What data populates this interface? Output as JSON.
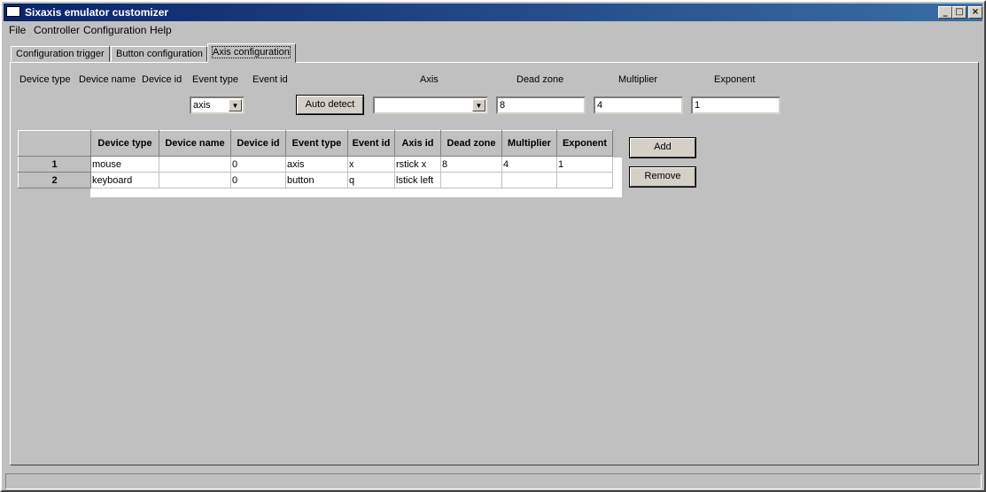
{
  "window": {
    "title": "Sixaxis emulator customizer"
  },
  "menu": [
    {
      "label": "File"
    },
    {
      "label": "Controller"
    },
    {
      "label": "Configuration"
    },
    {
      "label": "Help"
    }
  ],
  "tabs": [
    {
      "label": "Configuration trigger"
    },
    {
      "label": "Button configuration"
    },
    {
      "label": "Axis configuration"
    }
  ],
  "form": {
    "labels": {
      "device_type": "Device type",
      "device_name": "Device name",
      "device_id": "Device id",
      "event_type": "Event type",
      "event_id": "Event id",
      "axis": "Axis",
      "dead_zone": "Dead zone",
      "multiplier": "Multiplier",
      "exponent": "Exponent"
    },
    "event_type_value": "axis",
    "auto_detect_label": "Auto detect",
    "axis_value": "",
    "dead_zone_value": "8",
    "multiplier_value": "4",
    "exponent_value": "1"
  },
  "buttons": {
    "add": "Add",
    "remove": "Remove"
  },
  "table": {
    "columns": [
      "Device type",
      "Device name",
      "Device id",
      "Event type",
      "Event id",
      "Axis id",
      "Dead zone",
      "Multiplier",
      "Exponent"
    ],
    "rows": [
      {
        "num": "1",
        "cells": [
          "mouse",
          "",
          "0",
          "axis",
          "x",
          "rstick x",
          "8",
          "4",
          "1"
        ]
      },
      {
        "num": "2",
        "cells": [
          "keyboard",
          "",
          "0",
          "button",
          "q",
          "lstick left",
          "",
          "",
          ""
        ]
      }
    ]
  },
  "icons": {
    "title_controls": [
      "minimize-icon",
      "maximize-icon",
      "close-icon"
    ],
    "combo": "chevron-down-icon"
  }
}
